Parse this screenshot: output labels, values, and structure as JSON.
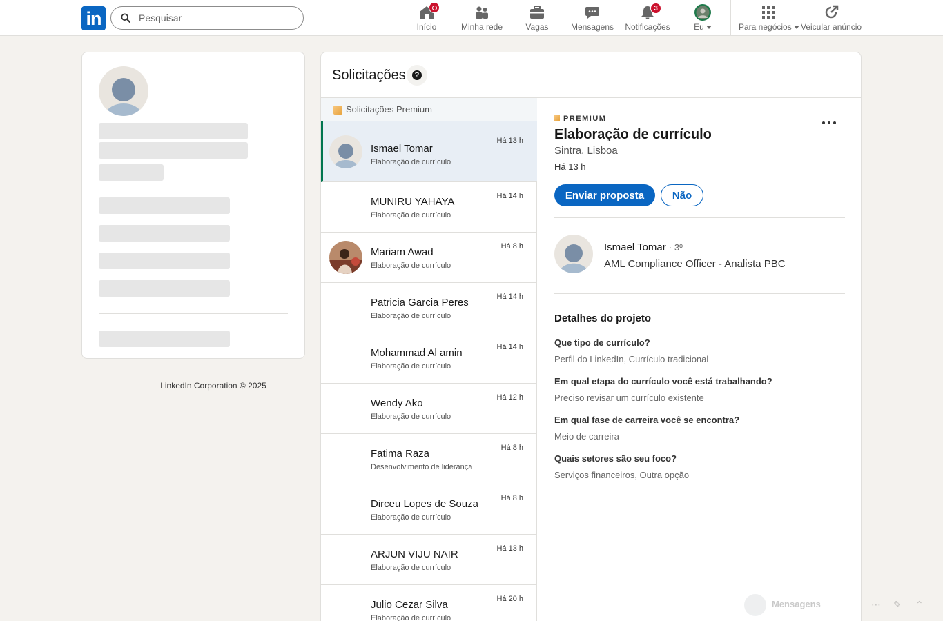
{
  "nav": {
    "search_placeholder": "Pesquisar",
    "items": [
      {
        "label": "Início",
        "icon": "home-icon"
      },
      {
        "label": "Minha rede",
        "icon": "network-icon"
      },
      {
        "label": "Vagas",
        "icon": "jobs-icon"
      },
      {
        "label": "Mensagens",
        "icon": "messaging-icon"
      },
      {
        "label": "Notificações",
        "icon": "bell-icon",
        "badge": "3"
      },
      {
        "label": "Eu",
        "icon": "avatar"
      },
      {
        "label": "Para negócios",
        "icon": "grid-icon"
      },
      {
        "label": "Veicular anúncio",
        "icon": "ad-icon"
      }
    ]
  },
  "footer": {
    "text": "LinkedIn Corporation © 2025"
  },
  "main": {
    "title": "Solicitações",
    "premium_header": "Solicitações Premium",
    "requests": [
      {
        "name": "Ismael Tomar",
        "service": "Elaboração de currículo",
        "time": "Há 13 h"
      },
      {
        "name": "MUNIRU YAHAYA",
        "service": "Elaboração de currículo",
        "time": "Há 14 h"
      },
      {
        "name": "Mariam Awad",
        "service": "Elaboração de currículo",
        "time": "Há 8 h"
      },
      {
        "name": "Patricia Garcia Peres",
        "service": "Elaboração de currículo",
        "time": "Há 14 h"
      },
      {
        "name": "Mohammad Al amin",
        "service": "Elaboração de currículo",
        "time": "Há 14 h"
      },
      {
        "name": "Wendy Ako",
        "service": "Elaboração de currículo",
        "time": "Há 12 h"
      },
      {
        "name": "Fatima Raza",
        "service": "Desenvolvimento de liderança",
        "time": "Há 8 h"
      },
      {
        "name": "Dirceu Lopes de Souza",
        "service": "Elaboração de currículo",
        "time": "Há 8 h"
      },
      {
        "name": "ARJUN VIJU NAIR",
        "service": "Elaboração de currículo",
        "time": "Há 13 h"
      },
      {
        "name": "Julio Cezar Silva",
        "service": "Elaboração de currículo",
        "time": "Há 20 h"
      }
    ]
  },
  "detail": {
    "badge": "PREMIUM",
    "title": "Elaboração de currículo",
    "location": "Sintra, Lisboa",
    "time": "Há 13 h",
    "primary_button": "Enviar proposta",
    "secondary_button": "Não",
    "person_name": "Ismael Tomar",
    "person_degree": "· 3º",
    "person_role": "AML Compliance Officer - Analista PBC",
    "section_title": "Detalhes do projeto",
    "qa": [
      {
        "q": "Que tipo de currículo?",
        "a": "Perfil do LinkedIn, Currículo tradicional"
      },
      {
        "q": "Em qual etapa do currículo você está trabalhando?",
        "a": "Preciso revisar um currículo existente"
      },
      {
        "q": "Em qual fase de carreira você se encontra?",
        "a": "Meio de carreira"
      },
      {
        "q": "Quais setores são seu foco?",
        "a": "Serviços financeiros, Outra opção"
      }
    ]
  },
  "messaging": {
    "label": "Mensagens"
  },
  "colors": {
    "brand": "#0a66c2",
    "active_marker": "#01754f",
    "badge": "#cb112d"
  }
}
